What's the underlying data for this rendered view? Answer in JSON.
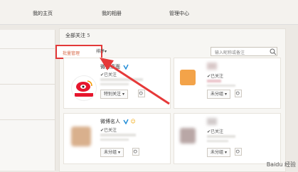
{
  "nav": [
    "我的主页",
    "我的相册",
    "管理中心"
  ],
  "main": {
    "title": "全部关注",
    "count": "5",
    "tab": "批量管理",
    "sort": "排序",
    "search_placeholder": "输入昵称或备注"
  },
  "cards": [
    {
      "name": "微博桌面",
      "status": "✔已关注",
      "group": "特别关注"
    },
    {
      "name": "",
      "status": "✔已关注",
      "group": "未分组"
    },
    {
      "name": "微博名人",
      "status": "✔已关注",
      "group": "未分组"
    },
    {
      "name": "",
      "status": "✔已关注",
      "group": "未分组"
    }
  ],
  "watermark": "Baidu 经验",
  "colors": {
    "highlight": "#e33939",
    "verified": "#1e8bd6"
  }
}
